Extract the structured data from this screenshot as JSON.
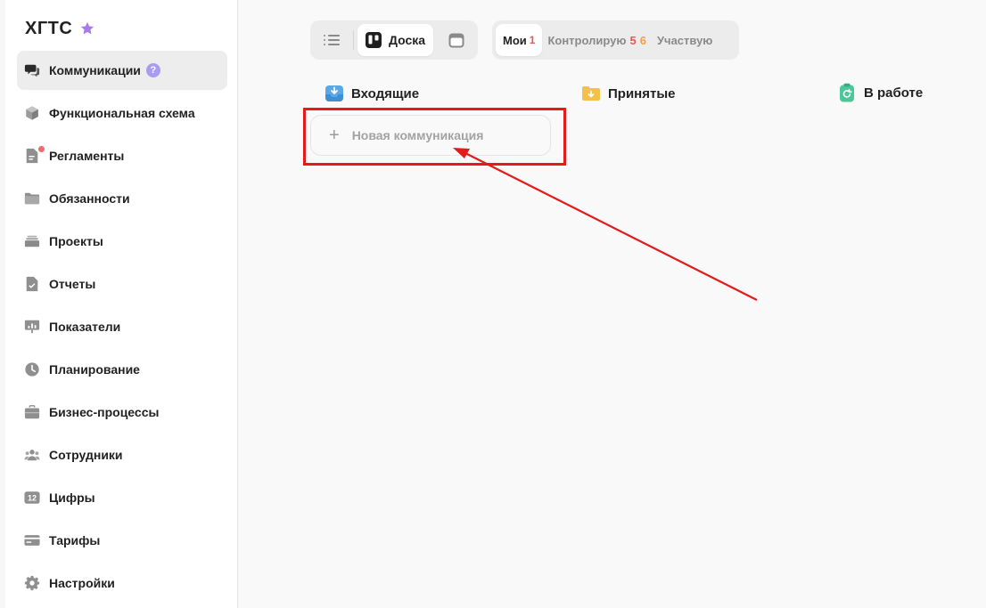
{
  "brand": {
    "title": "ХГТС",
    "star_icon": "star-icon",
    "star_color": "#a97be8"
  },
  "sidebar": {
    "items": [
      {
        "label": "Коммуникации",
        "icon": "chat-icon",
        "active": true,
        "help": "?"
      },
      {
        "label": "Функциональная схема",
        "icon": "cube-icon"
      },
      {
        "label": "Регламенты",
        "icon": "document-icon",
        "notification_dot": true
      },
      {
        "label": "Обязанности",
        "icon": "folder-icon"
      },
      {
        "label": "Проекты",
        "icon": "stack-icon"
      },
      {
        "label": "Отчеты",
        "icon": "report-check-icon"
      },
      {
        "label": "Показатели",
        "icon": "presentation-chart-icon"
      },
      {
        "label": "Планирование",
        "icon": "clock-icon"
      },
      {
        "label": "Бизнес-процессы",
        "icon": "briefcase-icon"
      },
      {
        "label": "Сотрудники",
        "icon": "users-icon"
      },
      {
        "label": "Цифры",
        "icon": "numbers-12-icon",
        "icon_text": "12"
      },
      {
        "label": "Тарифы",
        "icon": "card-icon"
      },
      {
        "label": "Настройки",
        "icon": "gear-icon"
      }
    ]
  },
  "toolbar": {
    "view_switch": {
      "list_icon": "list-icon",
      "board_icon": "board-icon",
      "board_label": "Доска",
      "calendar_icon": "calendar-icon",
      "selected": "board"
    },
    "filters": {
      "mine_label": "Мои",
      "mine_count": "1",
      "control_label": "Контролирую",
      "control_count_red": "5",
      "control_count_orange": "6",
      "participate_label": "Участвую",
      "selected": "mine"
    }
  },
  "board": {
    "columns": [
      {
        "title": "Входящие",
        "icon": "inbox-icon",
        "color": "#5aa8e8"
      },
      {
        "title": "Принятые",
        "icon": "folder-download-icon",
        "color": "#f3c04a"
      },
      {
        "title": "В работе",
        "icon": "clipboard-refresh-icon",
        "color": "#4cc79a"
      }
    ],
    "new_card": {
      "plus": "+",
      "label": "Новая коммуникация"
    }
  },
  "annotation": {
    "color": "#e41b1b"
  }
}
